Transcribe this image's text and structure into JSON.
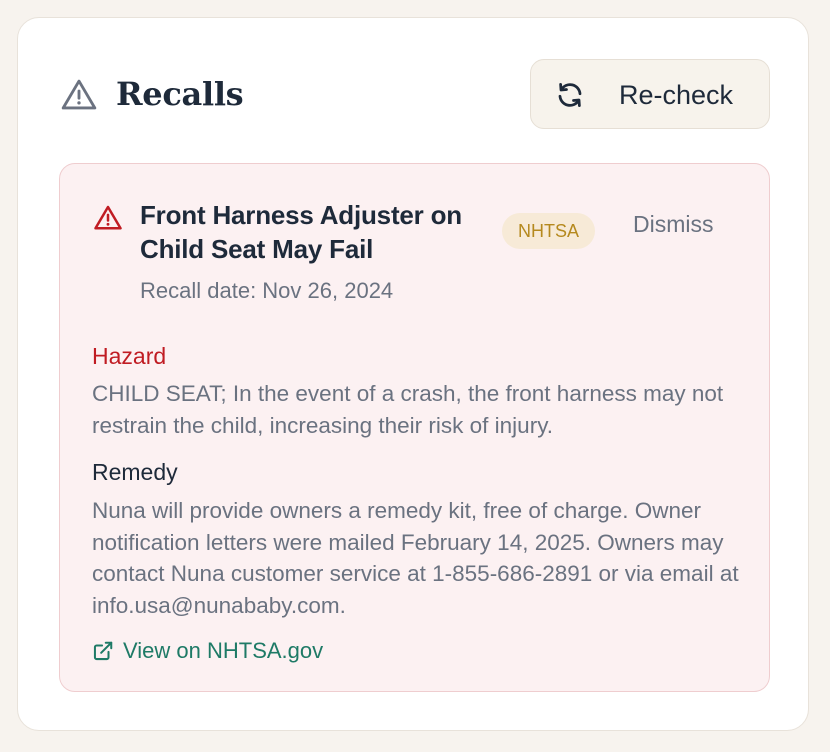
{
  "header": {
    "title": "Recalls",
    "icon": "warning-triangle-icon",
    "recheck_label": "Re-check",
    "recheck_icon": "refresh-icon"
  },
  "recall": {
    "title": "Front Harness Adjuster on Child Seat May Fail",
    "icon": "warning-triangle-icon",
    "badge": "NHTSA",
    "dismiss_label": "Dismiss",
    "date_text": "Recall date: Nov 26, 2024",
    "hazard_label": "Hazard",
    "hazard_text": "CHILD SEAT; In the event of a crash, the front harness may not restrain the child, increasing their risk of injury.",
    "remedy_label": "Remedy",
    "remedy_text": "Nuna will provide owners a remedy kit, free of charge. Owner notification letters were mailed February 14, 2025. Owners may contact Nuna customer service at 1-855-686-2891 or via email at info.usa@nunababy.com.",
    "link_label": "View on NHTSA.gov",
    "link_icon": "external-link-icon"
  },
  "colors": {
    "accent_red": "#c01c23",
    "link_green": "#1e7a66",
    "badge_gold": "#b5891e",
    "card_background": "#fcf1f2"
  }
}
